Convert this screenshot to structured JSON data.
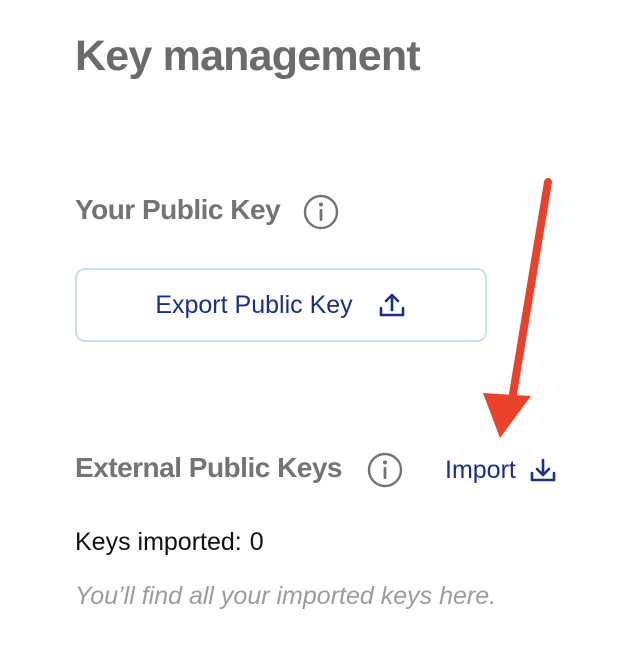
{
  "page": {
    "title": "Key management"
  },
  "your_key": {
    "heading": "Your Public Key",
    "export_label": "Export Public Key"
  },
  "external_keys": {
    "heading": "External Public Keys",
    "import_label": "Import",
    "count_label": "Keys imported:",
    "count": "0",
    "empty_message": "You’ll find all your imported keys here."
  },
  "icons": {
    "info": "info-circle-icon",
    "export": "upload-icon",
    "import": "download-icon",
    "annotation": "red-arrow-annotation"
  },
  "colors": {
    "heading": "#6b6b6b",
    "link": "#1b2f8a",
    "button_border": "#c9dcf7",
    "annotation": "#e8432a",
    "muted_text": "#9c9c9c"
  }
}
